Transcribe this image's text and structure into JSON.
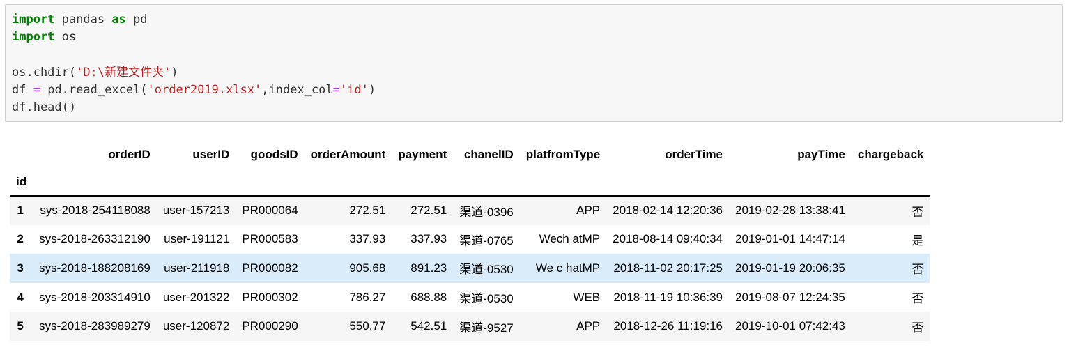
{
  "code_cell": {
    "lines": [
      [
        {
          "t": "import",
          "c": "kw"
        },
        {
          "t": " pandas ",
          "c": ""
        },
        {
          "t": "as",
          "c": "kw"
        },
        {
          "t": " pd",
          "c": ""
        }
      ],
      [
        {
          "t": "import",
          "c": "kw"
        },
        {
          "t": " os",
          "c": ""
        }
      ],
      [
        {
          "t": "",
          "c": ""
        }
      ],
      [
        {
          "t": "os.chdir(",
          "c": ""
        },
        {
          "t": "'D:\\新建文件夹'",
          "c": "str"
        },
        {
          "t": ")",
          "c": ""
        }
      ],
      [
        {
          "t": "df ",
          "c": ""
        },
        {
          "t": "=",
          "c": "op"
        },
        {
          "t": " pd.read_excel(",
          "c": ""
        },
        {
          "t": "'order2019.xlsx'",
          "c": "str"
        },
        {
          "t": ",index_col",
          "c": ""
        },
        {
          "t": "=",
          "c": "op"
        },
        {
          "t": "'id'",
          "c": "str"
        },
        {
          "t": ")",
          "c": ""
        }
      ],
      [
        {
          "t": "df.head()",
          "c": ""
        }
      ]
    ]
  },
  "dataframe": {
    "columns": [
      "orderID",
      "userID",
      "goodsID",
      "orderAmount",
      "payment",
      "chanelID",
      "platfromType",
      "orderTime",
      "payTime",
      "chargeback"
    ],
    "index_name": "id",
    "rows": [
      {
        "id": "1",
        "cells": [
          "sys-2018-254118088",
          "user-157213",
          "PR000064",
          "272.51",
          "272.51",
          "渠道-0396",
          "APP",
          "2018-02-14 12:20:36",
          "2019-02-28 13:38:41",
          "否"
        ]
      },
      {
        "id": "2",
        "cells": [
          "sys-2018-263312190",
          "user-191121",
          "PR000583",
          "337.93",
          "337.93",
          "渠道-0765",
          "Wech atMP",
          "2018-08-14 09:40:34",
          "2019-01-01 14:47:14",
          "是"
        ]
      },
      {
        "id": "3",
        "cells": [
          "sys-2018-188208169",
          "user-211918",
          "PR000082",
          "905.68",
          "891.23",
          "渠道-0530",
          "We c hatMP",
          "2018-11-02 20:17:25",
          "2019-01-19 20:06:35",
          "否"
        ]
      },
      {
        "id": "4",
        "cells": [
          "sys-2018-203314910",
          "user-201322",
          "PR000302",
          "786.27",
          "688.88",
          "渠道-0530",
          "WEB",
          "2018-11-19 10:36:39",
          "2019-08-07 12:24:35",
          "否"
        ]
      },
      {
        "id": "5",
        "cells": [
          "sys-2018-283989279",
          "user-120872",
          "PR000290",
          "550.77",
          "542.51",
          "渠道-9527",
          "APP",
          "2018-12-26 11:19:16",
          "2019-10-01 07:42:43",
          "否"
        ]
      }
    ],
    "hovered_row": 2
  }
}
